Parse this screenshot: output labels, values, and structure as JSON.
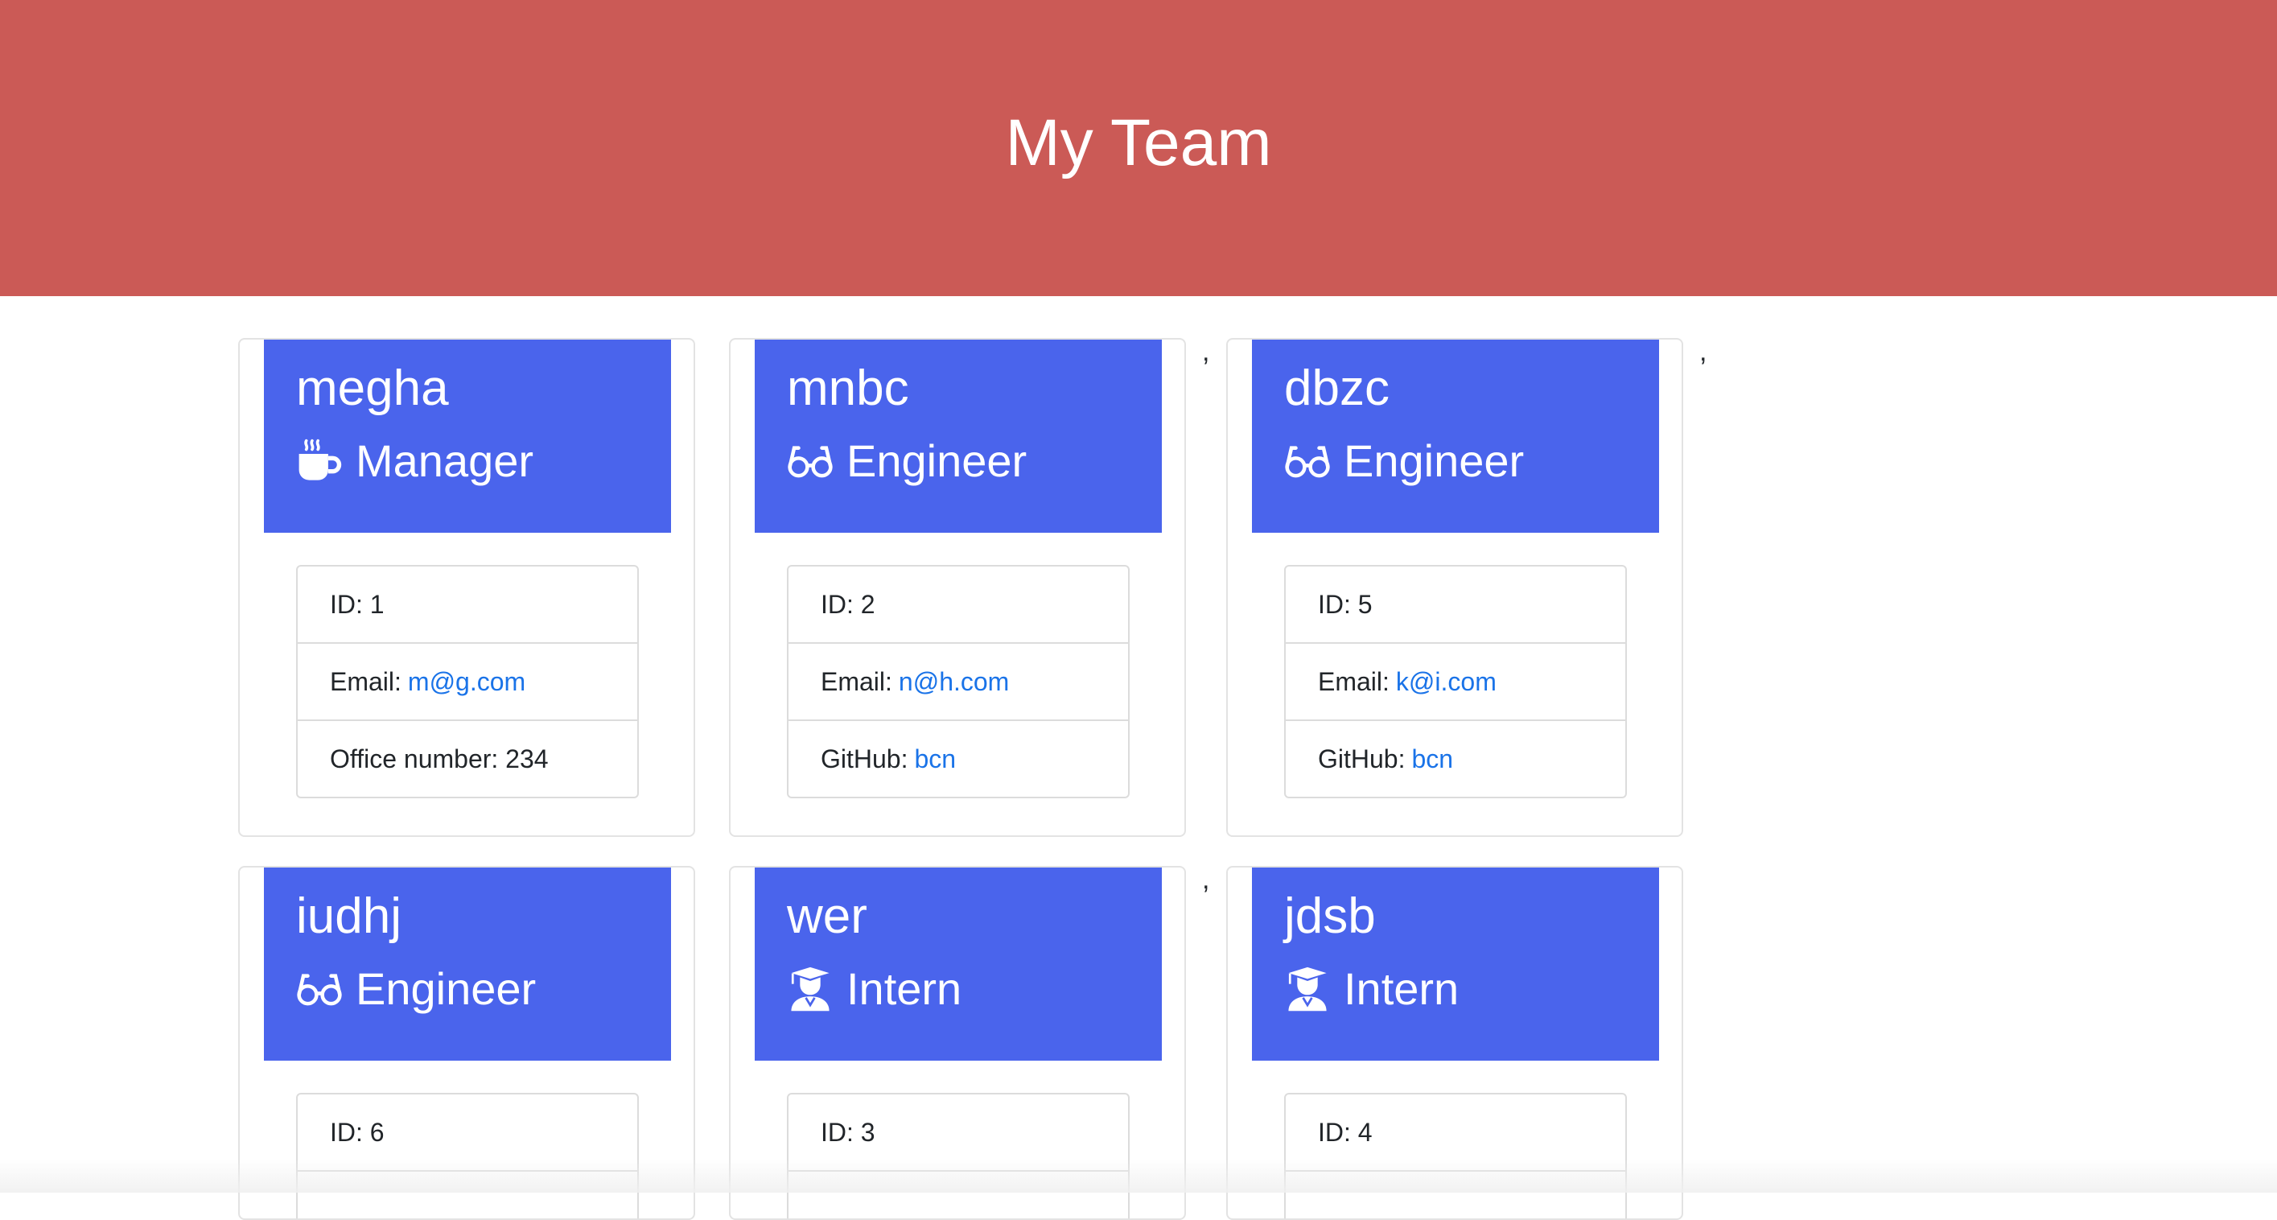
{
  "header": {
    "title": "My Team"
  },
  "colors": {
    "header_bg": "#cb5a56",
    "card_head_bg": "#4a64ec",
    "link": "#1a73e8"
  },
  "separators": [
    ",",
    ",",
    ","
  ],
  "cards": [
    {
      "name": "megha",
      "role": "Manager",
      "role_icon": "coffee-mug-icon",
      "rows": [
        {
          "label": "ID: 1",
          "link": ""
        },
        {
          "label": "Email:",
          "link": "m@g.com"
        },
        {
          "label": "Office number: 234",
          "link": ""
        }
      ]
    },
    {
      "name": "mnbc",
      "role": "Engineer",
      "role_icon": "glasses-icon",
      "rows": [
        {
          "label": "ID: 2",
          "link": ""
        },
        {
          "label": "Email:",
          "link": "n@h.com"
        },
        {
          "label": "GitHub:",
          "link": "bcn"
        }
      ]
    },
    {
      "name": "dbzc",
      "role": "Engineer",
      "role_icon": "glasses-icon",
      "rows": [
        {
          "label": "ID: 5",
          "link": ""
        },
        {
          "label": "Email:",
          "link": "k@i.com"
        },
        {
          "label": "GitHub:",
          "link": "bcn"
        }
      ]
    },
    {
      "name": "iudhj",
      "role": "Engineer",
      "role_icon": "glasses-icon",
      "rows": [
        {
          "label": "ID: 6",
          "link": ""
        }
      ]
    },
    {
      "name": "wer",
      "role": "Intern",
      "role_icon": "graduate-icon",
      "rows": [
        {
          "label": "ID: 3",
          "link": ""
        }
      ]
    },
    {
      "name": "jdsb",
      "role": "Intern",
      "role_icon": "graduate-icon",
      "rows": [
        {
          "label": "ID: 4",
          "link": ""
        }
      ]
    }
  ]
}
